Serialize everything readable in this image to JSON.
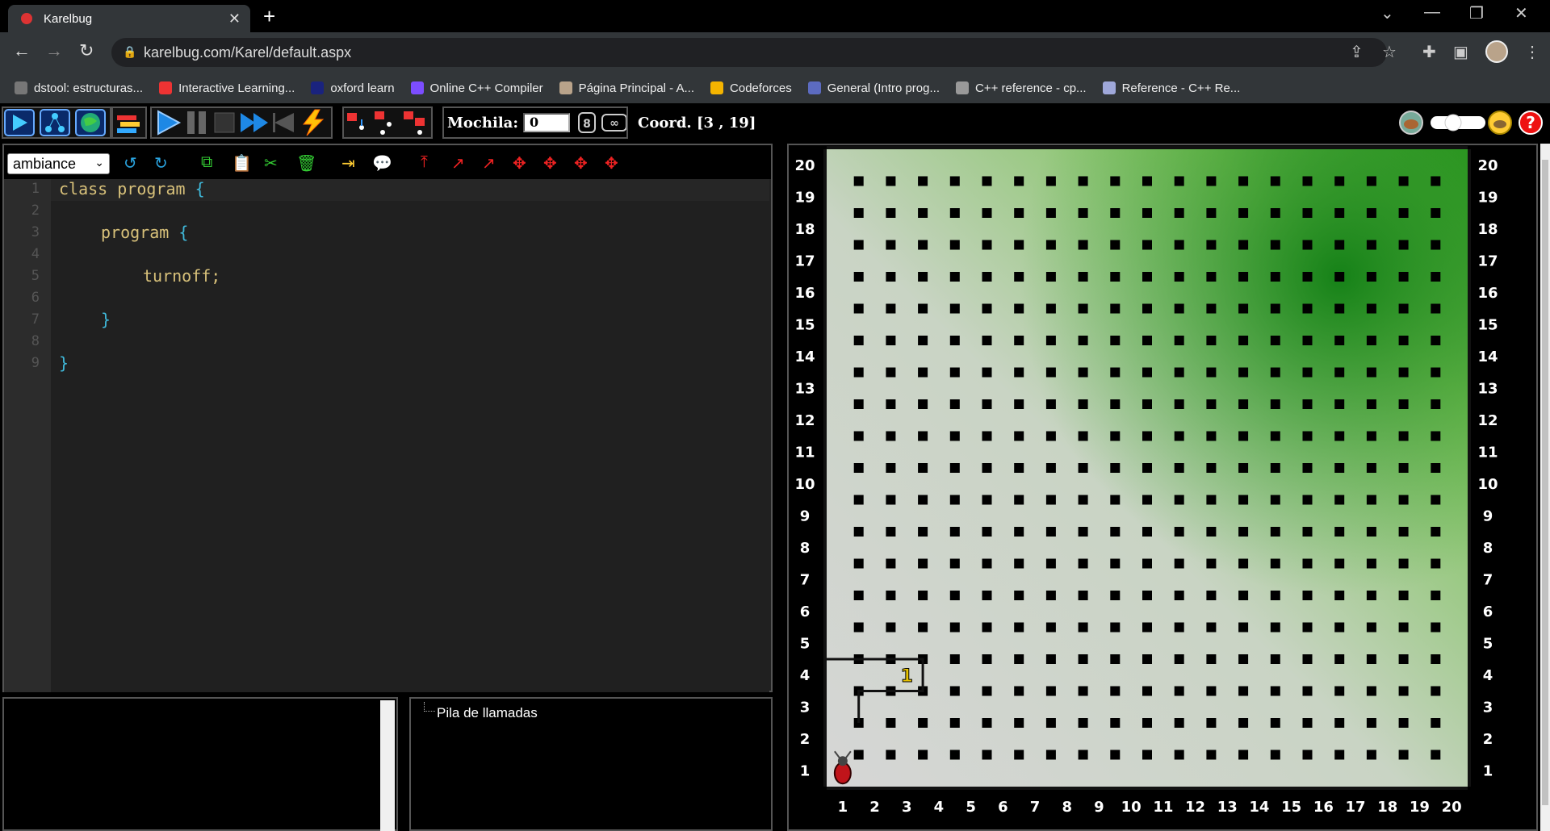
{
  "browser": {
    "tab_title": "Karelbug",
    "url": "karelbug.com/Karel/default.aspx",
    "bookmarks": [
      {
        "label": "dstool: estructuras...",
        "color": "#777"
      },
      {
        "label": "Interactive Learning...",
        "color": "#e33"
      },
      {
        "label": "oxford learn",
        "color": "#1a237e"
      },
      {
        "label": "Online C++ Compiler",
        "color": "#7c4dff"
      },
      {
        "label": "Página Principal - A...",
        "color": "#b9a38a"
      },
      {
        "label": "Codeforces",
        "color": "#f4b400"
      },
      {
        "label": "General (Intro prog...",
        "color": "#5c6bc0"
      },
      {
        "label": "C++ reference - cp...",
        "color": "#999"
      },
      {
        "label": "Reference - C++ Re...",
        "color": "#9fa8da"
      }
    ]
  },
  "toolbar": {
    "mochila_label": "Mochila:",
    "mochila_value": "0",
    "coord_label": "Coord. [3 , 19]"
  },
  "editor": {
    "theme": "ambiance",
    "line_numbers": [
      "1",
      "2",
      "3",
      "4",
      "5",
      "6",
      "7",
      "8",
      "9"
    ],
    "lines": [
      {
        "indent": 0,
        "kw": "class program ",
        "br": "{"
      },
      {
        "indent": 0,
        "kw": "",
        "br": ""
      },
      {
        "indent": 1,
        "kw": "program ",
        "br": "{"
      },
      {
        "indent": 0,
        "kw": "",
        "br": ""
      },
      {
        "indent": 2,
        "kw": "turnoff;",
        "br": ""
      },
      {
        "indent": 0,
        "kw": "",
        "br": ""
      },
      {
        "indent": 1,
        "kw": "",
        "br": "}"
      },
      {
        "indent": 0,
        "kw": "",
        "br": ""
      },
      {
        "indent": 0,
        "kw": "",
        "br": "}"
      }
    ]
  },
  "stack": {
    "label": "Pila de llamadas"
  },
  "world": {
    "rows": 20,
    "cols": 20,
    "beeper": {
      "avenue": 3,
      "street": 4,
      "count": "1"
    },
    "karel": {
      "avenue": 1,
      "street": 1,
      "icon": "bug-icon"
    },
    "colors": {
      "dots": "#000000",
      "labels": "#ffffff",
      "gradient_light": "#d6d6d6",
      "gradient_green": "#4caf30"
    }
  }
}
